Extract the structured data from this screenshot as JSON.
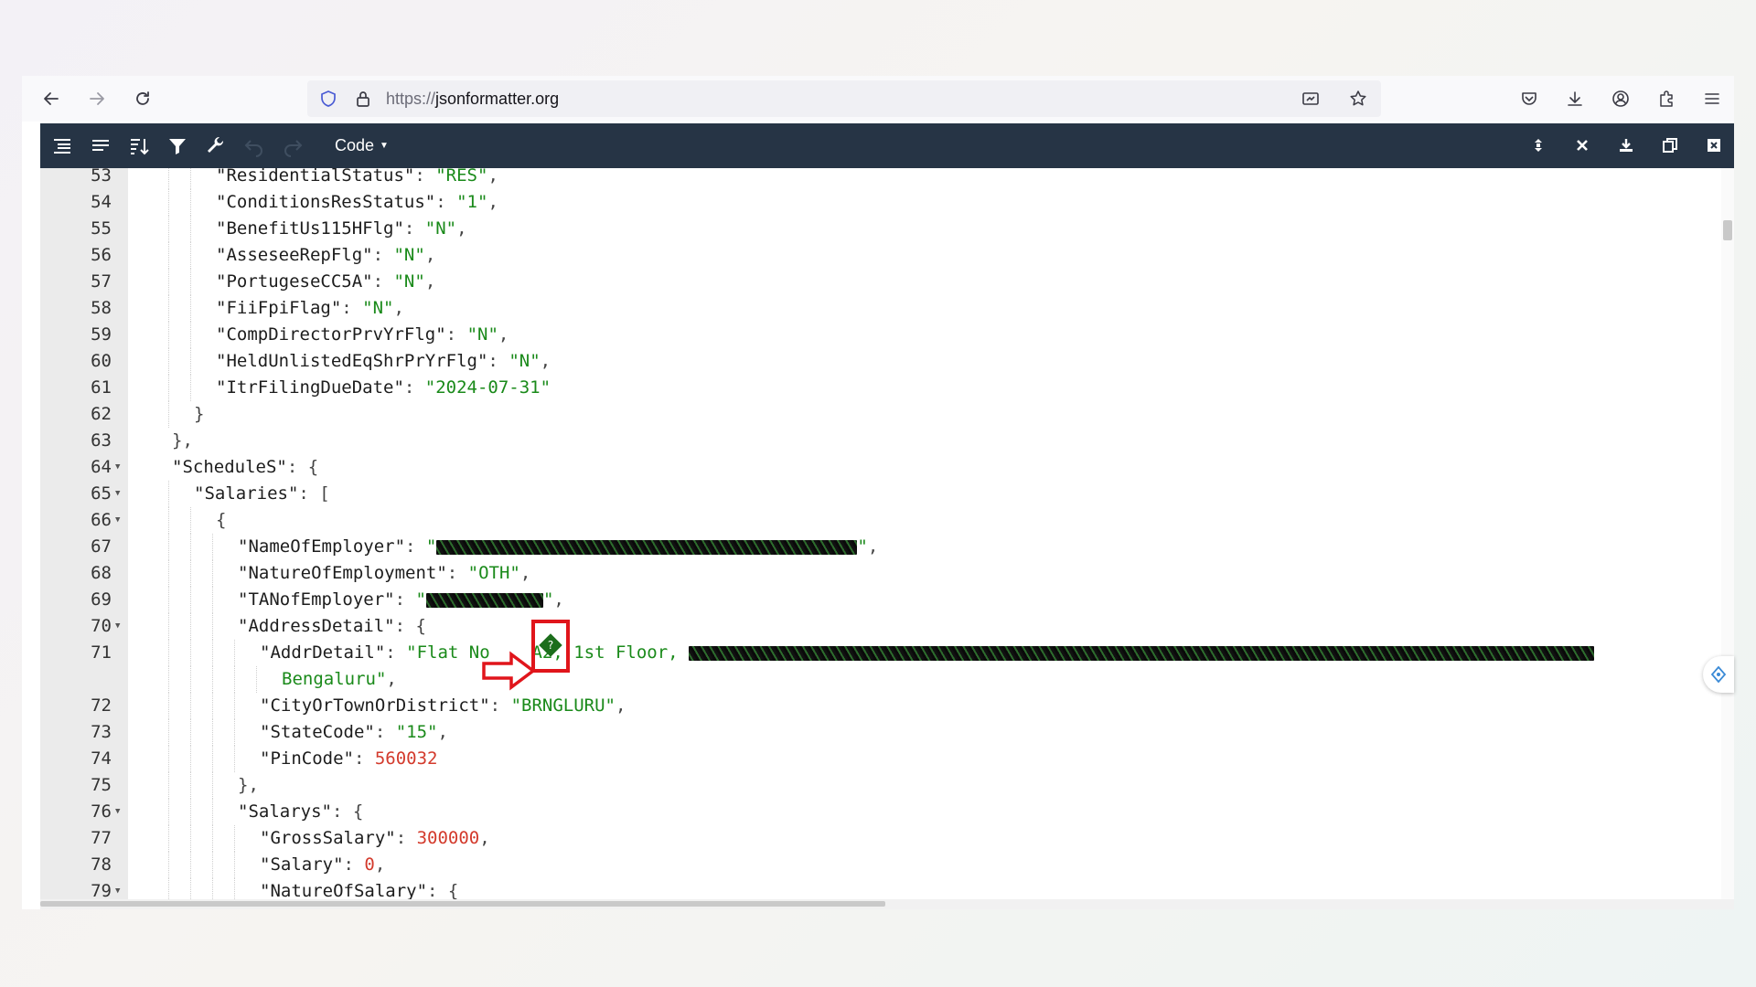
{
  "browser": {
    "url_scheme": "https://",
    "url_host": "jsonformatter.org"
  },
  "editor_toolbar": {
    "mode_label": "Code",
    "mode_caret": "▼"
  },
  "code_lines": [
    {
      "num": "53",
      "fold": false,
      "indent": 3,
      "tokens": [
        {
          "t": "k",
          "v": "\"ResidentialStatus\""
        },
        {
          "t": "p",
          "v": ": "
        },
        {
          "t": "s",
          "v": "\"RES\""
        },
        {
          "t": "p",
          "v": ","
        }
      ]
    },
    {
      "num": "54",
      "fold": false,
      "indent": 3,
      "tokens": [
        {
          "t": "k",
          "v": "\"ConditionsResStatus\""
        },
        {
          "t": "p",
          "v": ": "
        },
        {
          "t": "s",
          "v": "\"1\""
        },
        {
          "t": "p",
          "v": ","
        }
      ]
    },
    {
      "num": "55",
      "fold": false,
      "indent": 3,
      "tokens": [
        {
          "t": "k",
          "v": "\"BenefitUs115HFlg\""
        },
        {
          "t": "p",
          "v": ": "
        },
        {
          "t": "s",
          "v": "\"N\""
        },
        {
          "t": "p",
          "v": ","
        }
      ]
    },
    {
      "num": "56",
      "fold": false,
      "indent": 3,
      "tokens": [
        {
          "t": "k",
          "v": "\"AsseseeRepFlg\""
        },
        {
          "t": "p",
          "v": ": "
        },
        {
          "t": "s",
          "v": "\"N\""
        },
        {
          "t": "p",
          "v": ","
        }
      ]
    },
    {
      "num": "57",
      "fold": false,
      "indent": 3,
      "tokens": [
        {
          "t": "k",
          "v": "\"PortugeseCC5A\""
        },
        {
          "t": "p",
          "v": ": "
        },
        {
          "t": "s",
          "v": "\"N\""
        },
        {
          "t": "p",
          "v": ","
        }
      ]
    },
    {
      "num": "58",
      "fold": false,
      "indent": 3,
      "tokens": [
        {
          "t": "k",
          "v": "\"FiiFpiFlag\""
        },
        {
          "t": "p",
          "v": ": "
        },
        {
          "t": "s",
          "v": "\"N\""
        },
        {
          "t": "p",
          "v": ","
        }
      ]
    },
    {
      "num": "59",
      "fold": false,
      "indent": 3,
      "tokens": [
        {
          "t": "k",
          "v": "\"CompDirectorPrvYrFlg\""
        },
        {
          "t": "p",
          "v": ": "
        },
        {
          "t": "s",
          "v": "\"N\""
        },
        {
          "t": "p",
          "v": ","
        }
      ]
    },
    {
      "num": "60",
      "fold": false,
      "indent": 3,
      "tokens": [
        {
          "t": "k",
          "v": "\"HeldUnlistedEqShrPrYrFlg\""
        },
        {
          "t": "p",
          "v": ": "
        },
        {
          "t": "s",
          "v": "\"N\""
        },
        {
          "t": "p",
          "v": ","
        }
      ]
    },
    {
      "num": "61",
      "fold": false,
      "indent": 3,
      "tokens": [
        {
          "t": "k",
          "v": "\"ItrFilingDueDate\""
        },
        {
          "t": "p",
          "v": ": "
        },
        {
          "t": "s",
          "v": "\"2024-07-31\""
        }
      ]
    },
    {
      "num": "62",
      "fold": false,
      "indent": 2,
      "tokens": [
        {
          "t": "p",
          "v": "}"
        }
      ]
    },
    {
      "num": "63",
      "fold": false,
      "indent": 1,
      "tokens": [
        {
          "t": "p",
          "v": "},"
        }
      ]
    },
    {
      "num": "64",
      "fold": true,
      "indent": 1,
      "tokens": [
        {
          "t": "k",
          "v": "\"ScheduleS\""
        },
        {
          "t": "p",
          "v": ": {"
        }
      ]
    },
    {
      "num": "65",
      "fold": true,
      "indent": 2,
      "tokens": [
        {
          "t": "k",
          "v": "\"Salaries\""
        },
        {
          "t": "p",
          "v": ": ["
        }
      ]
    },
    {
      "num": "66",
      "fold": true,
      "indent": 3,
      "tokens": [
        {
          "t": "p",
          "v": "{"
        }
      ]
    },
    {
      "num": "67",
      "fold": false,
      "indent": 4,
      "tokens": [
        {
          "t": "k",
          "v": "\"NameOfEmployer\""
        },
        {
          "t": "p",
          "v": ": "
        },
        {
          "t": "s",
          "v": "\""
        },
        {
          "t": "m",
          "v": "460"
        },
        {
          "t": "s",
          "v": "\""
        },
        {
          "t": "p",
          "v": ","
        }
      ]
    },
    {
      "num": "68",
      "fold": false,
      "indent": 4,
      "tokens": [
        {
          "t": "k",
          "v": "\"NatureOfEmployment\""
        },
        {
          "t": "p",
          "v": ": "
        },
        {
          "t": "s",
          "v": "\"OTH\""
        },
        {
          "t": "p",
          "v": ","
        }
      ]
    },
    {
      "num": "69",
      "fold": false,
      "indent": 4,
      "tokens": [
        {
          "t": "k",
          "v": "\"TANofEmployer\""
        },
        {
          "t": "p",
          "v": ": "
        },
        {
          "t": "s",
          "v": "\""
        },
        {
          "t": "m",
          "v": "128"
        },
        {
          "t": "s",
          "v": "\""
        },
        {
          "t": "p",
          "v": ","
        }
      ]
    },
    {
      "num": "70",
      "fold": true,
      "indent": 4,
      "tokens": [
        {
          "t": "k",
          "v": "\"AddressDetail\""
        },
        {
          "t": "p",
          "v": ": {"
        }
      ]
    },
    {
      "num": "71",
      "fold": false,
      "indent": 5,
      "tokens": [
        {
          "t": "k",
          "v": "\"AddrDetail\""
        },
        {
          "t": "p",
          "v": ": "
        },
        {
          "t": "s",
          "v": "\"Flat No"
        },
        {
          "t": "s",
          "v": "    A2, 1st Floor, "
        },
        {
          "t": "m",
          "v": "990"
        }
      ]
    },
    {
      "num": "",
      "fold": false,
      "indent": 6,
      "tokens": [
        {
          "t": "s",
          "v": "Bengaluru\""
        },
        {
          "t": "p",
          "v": ","
        }
      ]
    },
    {
      "num": "72",
      "fold": false,
      "indent": 5,
      "tokens": [
        {
          "t": "k",
          "v": "\"CityOrTownOrDistrict\""
        },
        {
          "t": "p",
          "v": ": "
        },
        {
          "t": "s",
          "v": "\"BRNGLURU\""
        },
        {
          "t": "p",
          "v": ","
        }
      ]
    },
    {
      "num": "73",
      "fold": false,
      "indent": 5,
      "tokens": [
        {
          "t": "k",
          "v": "\"StateCode\""
        },
        {
          "t": "p",
          "v": ": "
        },
        {
          "t": "s",
          "v": "\"15\""
        },
        {
          "t": "p",
          "v": ","
        }
      ]
    },
    {
      "num": "74",
      "fold": false,
      "indent": 5,
      "tokens": [
        {
          "t": "k",
          "v": "\"PinCode\""
        },
        {
          "t": "p",
          "v": ": "
        },
        {
          "t": "n",
          "v": "560032"
        }
      ]
    },
    {
      "num": "75",
      "fold": false,
      "indent": 4,
      "tokens": [
        {
          "t": "p",
          "v": "},"
        }
      ]
    },
    {
      "num": "76",
      "fold": true,
      "indent": 4,
      "tokens": [
        {
          "t": "k",
          "v": "\"Salarys\""
        },
        {
          "t": "p",
          "v": ": {"
        }
      ]
    },
    {
      "num": "77",
      "fold": false,
      "indent": 5,
      "tokens": [
        {
          "t": "k",
          "v": "\"GrossSalary\""
        },
        {
          "t": "p",
          "v": ": "
        },
        {
          "t": "n",
          "v": "300000"
        },
        {
          "t": "p",
          "v": ","
        }
      ]
    },
    {
      "num": "78",
      "fold": false,
      "indent": 5,
      "tokens": [
        {
          "t": "k",
          "v": "\"Salary\""
        },
        {
          "t": "p",
          "v": ": "
        },
        {
          "t": "n",
          "v": "0"
        },
        {
          "t": "p",
          "v": ","
        }
      ]
    },
    {
      "num": "79",
      "fold": true,
      "indent": 5,
      "tokens": [
        {
          "t": "k",
          "v": "\"NatureOfSalary\""
        },
        {
          "t": "p",
          "v": ": {"
        }
      ]
    }
  ],
  "annotation": {
    "marker_glyph": "?",
    "highlight_color": "#e0151b"
  },
  "colors": {
    "toolbar_bg": "#263445",
    "string": "#1a8a1a",
    "number": "#d33a2c",
    "gutter_bg": "#ebebeb"
  }
}
